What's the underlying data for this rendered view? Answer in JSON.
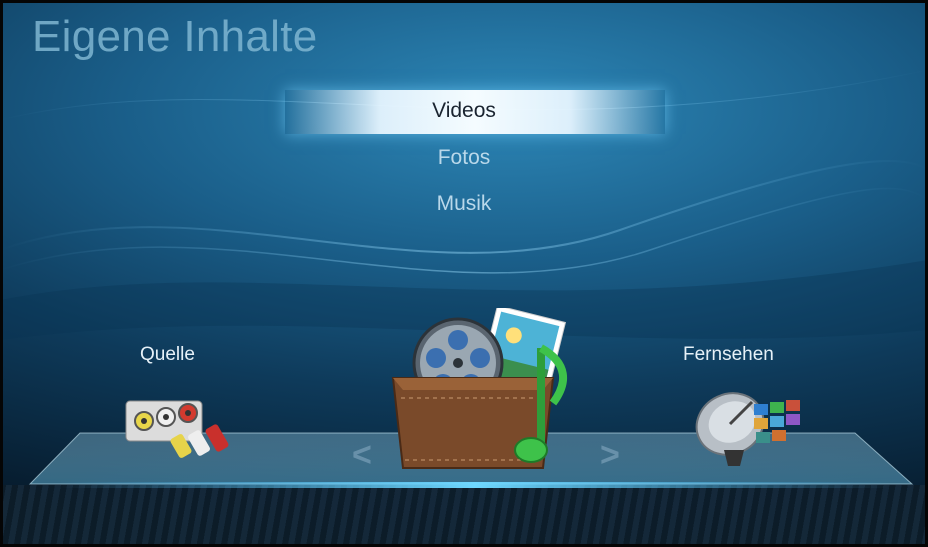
{
  "app": {
    "title": "Eigene Inhalte"
  },
  "menu": {
    "items": [
      {
        "label": "Videos",
        "selected": true
      },
      {
        "label": "Fotos",
        "selected": false
      },
      {
        "label": "Musik",
        "selected": false
      }
    ]
  },
  "carousel": {
    "left_label": "Quelle",
    "right_label": "Fernsehen",
    "prev_glyph": "<",
    "next_glyph": ">",
    "left_icon": "av-cable-connector-icon",
    "center_icon": "media-box-icon",
    "right_icon": "satellite-tv-icon"
  },
  "colors": {
    "accent": "#4fc3ff",
    "background": "#1a5e89"
  }
}
